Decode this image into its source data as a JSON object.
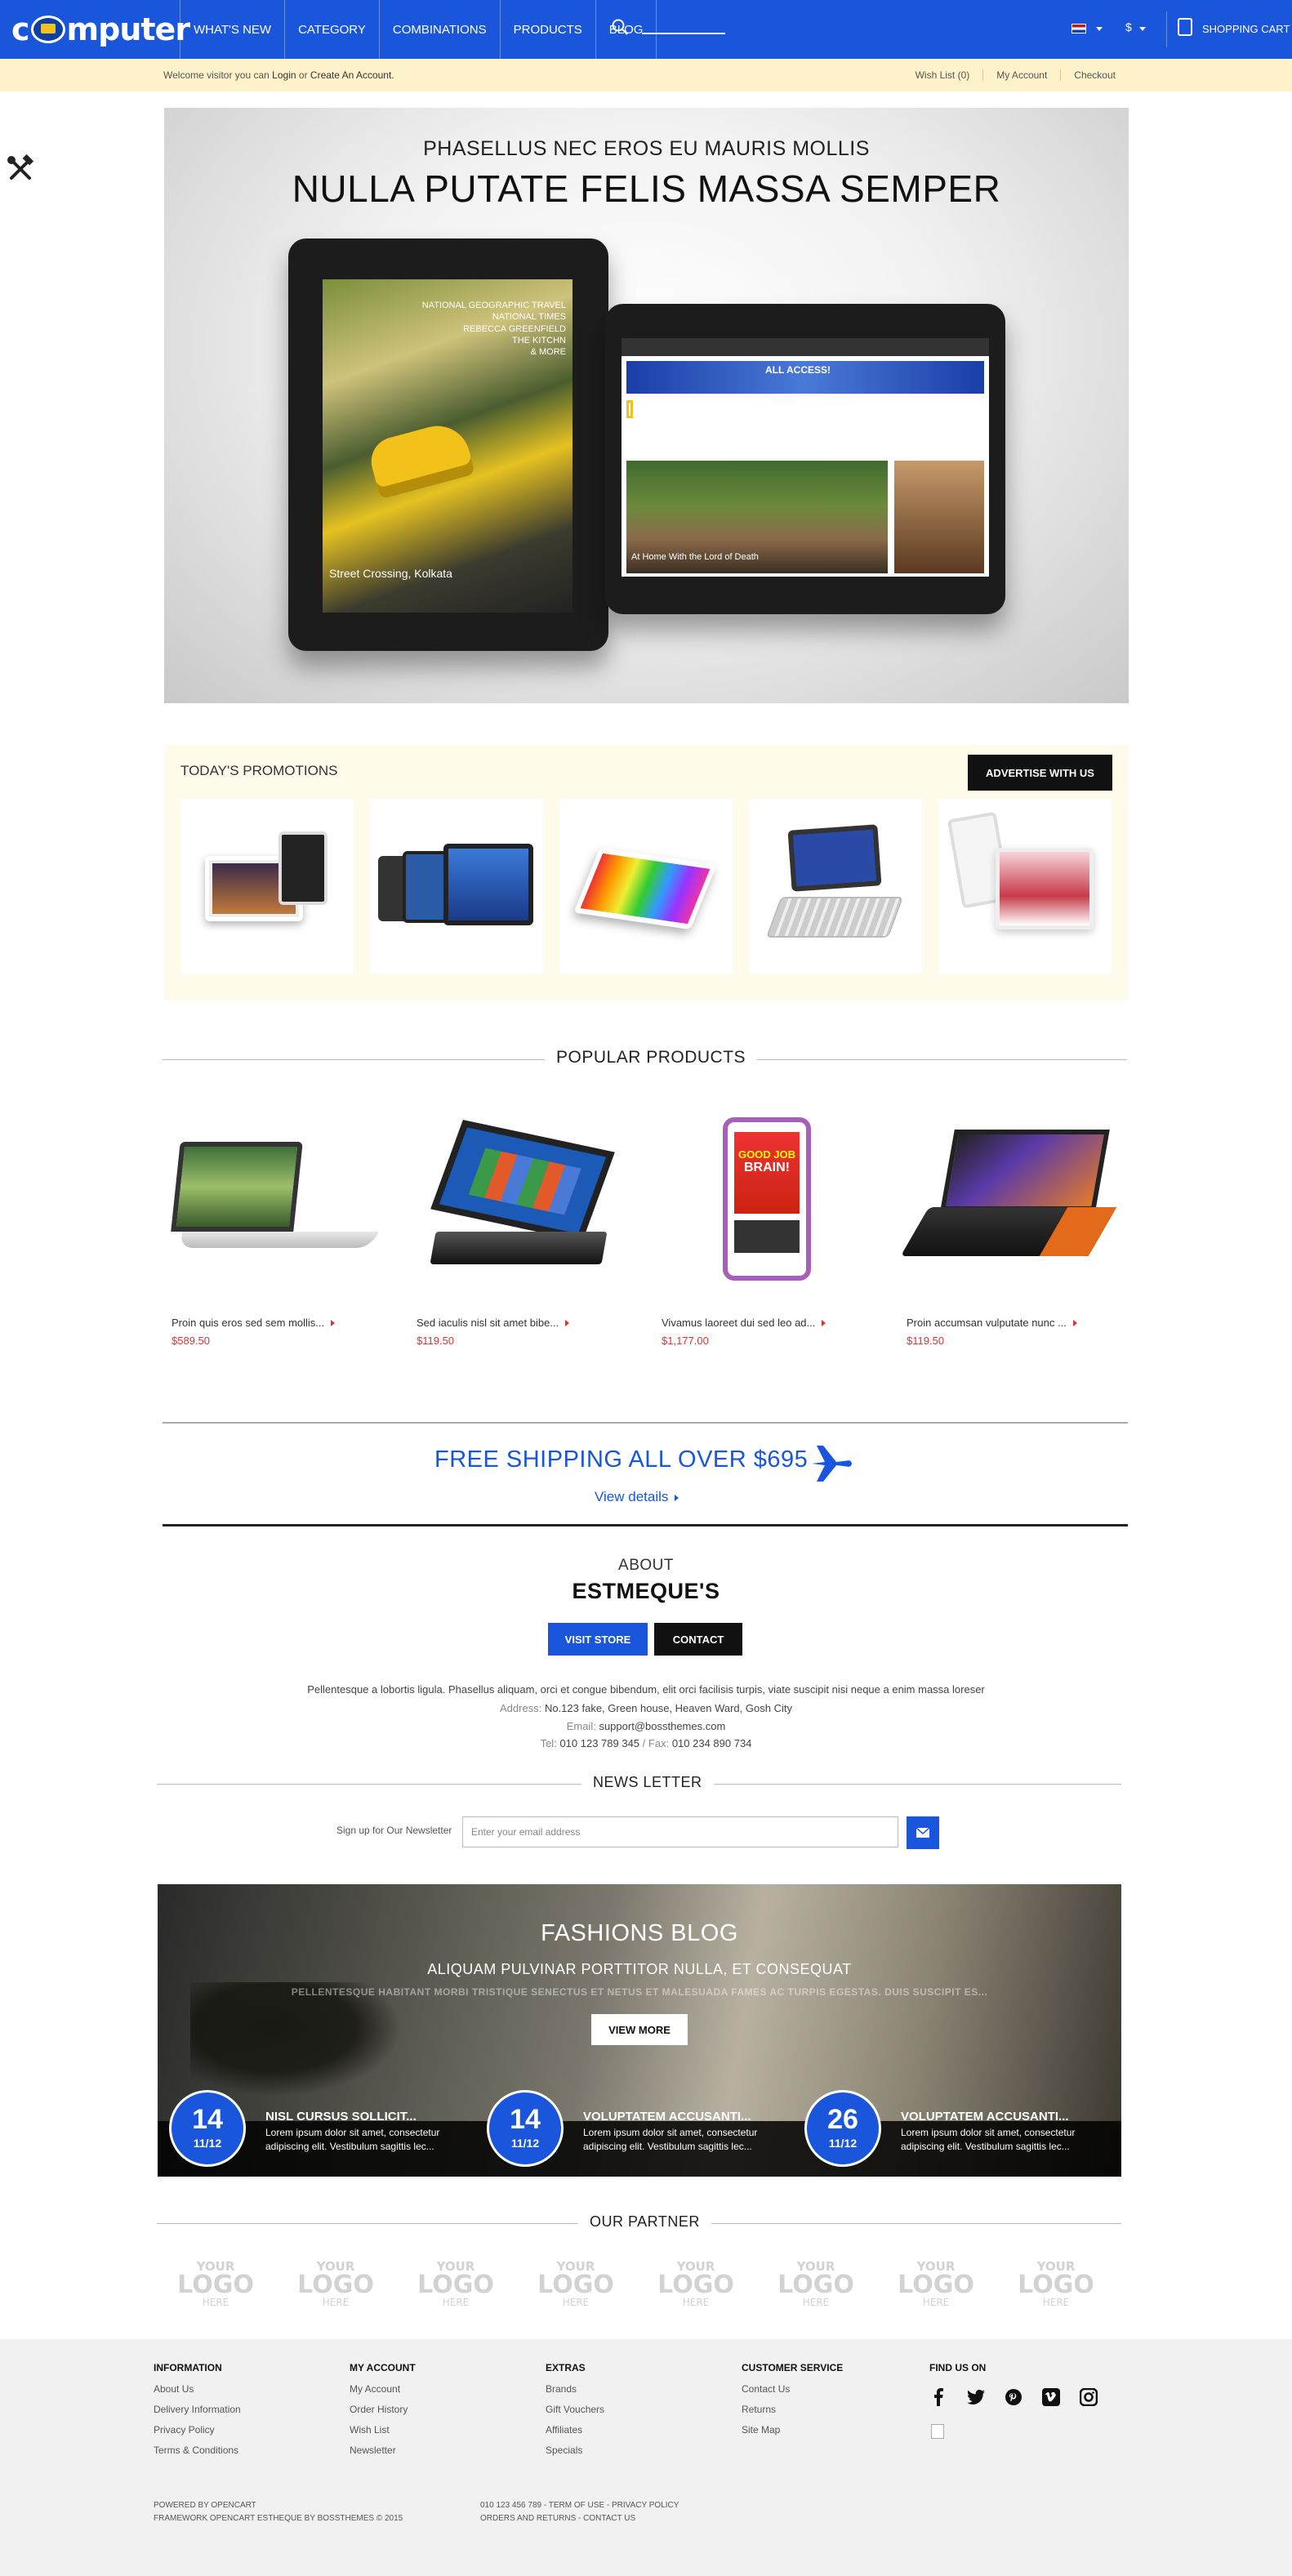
{
  "header": {
    "logo_text": "Computer",
    "nav": [
      "WHAT'S NEW",
      "CATEGORY",
      "COMBINATIONS",
      "PRODUCTS",
      "BLOG"
    ],
    "currency": "$",
    "cart_label": "SHOPPING CART",
    "accent_color": "#1a56db"
  },
  "subbar": {
    "welcome_prefix": "Welcome visitor you can",
    "login": "Login",
    "or": "or",
    "create": "Create An Account.",
    "links": [
      "Wish List (0)",
      "My Account",
      "Checkout"
    ]
  },
  "banner": {
    "subtitle": "PHASELLUS NEC EROS EU MAURIS MOLLIS",
    "title": "NULLA PUTATE FELIS MASSA SEMPER",
    "tablet1_caption": "Street Crossing, Kolkata",
    "tablet1_side": "NATIONAL GEOGRAPHIC TRAVEL\nNATIONAL TIMES\nREBECCA GREENFIELD\nTHE KITCHN\n& MORE",
    "tablet2_ad": "ALL ACCESS!",
    "tablet2_caption": "At Home With the Lord of Death"
  },
  "promotions": {
    "title": "TODAY'S PROMOTIONS",
    "button": "ADVERTISE WITH US"
  },
  "popular": {
    "heading": "POPULAR PRODUCTS",
    "products": [
      {
        "name": "Proin quis eros sed sem mollis...",
        "price": "$589.50"
      },
      {
        "name": "Sed iaculis nisl sit amet bibe...",
        "price": "$119.50"
      },
      {
        "name": "Vivamus laoreet dui sed leo ad...",
        "price": "$1,177.00"
      },
      {
        "name": "Proin accumsan vulputate nunc ...",
        "price": "$119.50"
      }
    ]
  },
  "shipping": {
    "title": "FREE SHIPPING ALL OVER $695",
    "link": "View details"
  },
  "about": {
    "small": "ABOUT",
    "big": "ESTMEQUE'S",
    "visit": "VISIT STORE",
    "contact": "CONTACT",
    "text": "Pellentesque a lobortis ligula. Phasellus aliquam, orci et congue bibendum, elit orci facilisis turpis, viate suscipit nisi neque a enim massa loreser",
    "address_label": "Address:",
    "address": "No.123 fake, Green house, Heaven Ward, Gosh City",
    "email_label": "Email:",
    "email": "support@bossthemes.com",
    "tel_label": "Tel:",
    "tel": "010 123 789 345",
    "fax_label": "/ Fax:",
    "fax": "010 234 890 734"
  },
  "newsletter": {
    "heading": "NEWS LETTER",
    "label": "Sign up for Our Newsletter",
    "placeholder": "Enter your email address"
  },
  "blog": {
    "title": "FASHIONS BLOG",
    "subtitle": "ALIQUAM PULVINAR PORTTITOR NULLA, ET CONSEQUAT",
    "subtitle2": "PELLENTESQUE HABITANT MORBI TRISTIQUE SENECTUS ET NETUS ET MALESUADA FAMES AC TURPIS EGESTAS. DUIS SUSCIPIT ES...",
    "button": "VIEW MORE",
    "posts": [
      {
        "day": "14",
        "month": "11/12",
        "title": "NISL CURSUS SOLLICIT...",
        "desc": "Lorem ipsum dolor sit amet, consectetur adipiscing elit. Vestibulum sagittis lec..."
      },
      {
        "day": "14",
        "month": "11/12",
        "title": "VOLUPTATEM ACCUSANTI...",
        "desc": "Lorem ipsum dolor sit amet, consectetur adipiscing elit. Vestibulum sagittis lec..."
      },
      {
        "day": "26",
        "month": "11/12",
        "title": "VOLUPTATEM ACCUSANTI...",
        "desc": "Lorem ipsum dolor sit amet, consectetur adipiscing elit. Vestibulum sagittis lec..."
      }
    ]
  },
  "partners": {
    "heading": "OUR PARTNER",
    "logo": {
      "top": "YOUR",
      "mid": "LOGO",
      "bottom": "HERE"
    }
  },
  "footer": {
    "columns": [
      {
        "title": "INFORMATION",
        "items": [
          "About Us",
          "Delivery Information",
          "Privacy Policy",
          "Terms & Conditions"
        ]
      },
      {
        "title": "MY ACCOUNT",
        "items": [
          "My Account",
          "Order History",
          "Wish List",
          "Newsletter"
        ]
      },
      {
        "title": "EXTRAS",
        "items": [
          "Brands",
          "Gift Vouchers",
          "Affiliates",
          "Specials"
        ]
      },
      {
        "title": "CUSTOMER SERVICE",
        "items": [
          "Contact Us",
          "Returns",
          "Site Map"
        ]
      },
      {
        "title": "FIND US ON",
        "items": []
      }
    ],
    "social_icons": [
      "facebook-icon",
      "twitter-icon",
      "pinterest-icon",
      "vimeo-icon",
      "instagram-icon"
    ],
    "powered": "POWERED BY OPENCART",
    "framework": "FRAMEWORK OPENCART ESTHEQUE BY BOSSTHEMES © 2015",
    "phone_line": "010 123 456 789 - TERM OF USE - PRIVACY POLICY",
    "orders_line": "ORDERS AND RETURNS - CONTACT US"
  }
}
